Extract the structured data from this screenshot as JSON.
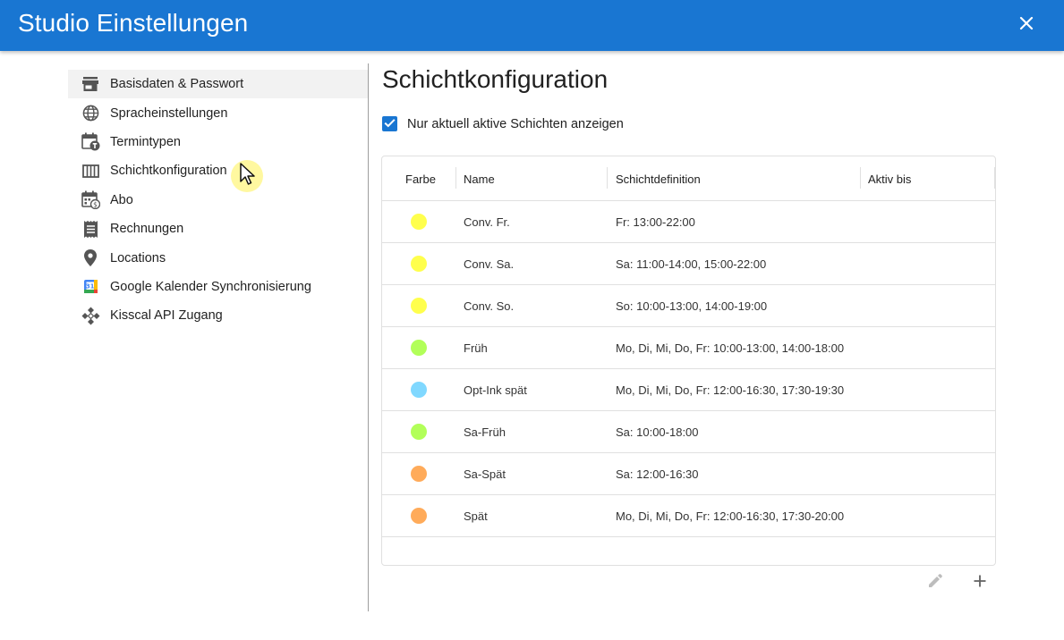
{
  "header": {
    "title": "Studio Einstellungen",
    "close_icon": "close-icon",
    "color": "#1976d2"
  },
  "sidebar": {
    "items": [
      {
        "label": "Basisdaten & Passwort",
        "icon": "store-icon",
        "active": true
      },
      {
        "label": "Spracheinstellungen",
        "icon": "globe-icon",
        "active": false
      },
      {
        "label": "Termintypen",
        "icon": "calendar-type-icon",
        "active": false
      },
      {
        "label": "Schichtkonfiguration",
        "icon": "columns-icon",
        "active": false
      },
      {
        "label": "Abo",
        "icon": "calendar-billing-icon",
        "active": false
      },
      {
        "label": "Rechnungen",
        "icon": "receipt-icon",
        "active": false
      },
      {
        "label": "Locations",
        "icon": "location-pin-icon",
        "active": false
      },
      {
        "label": "Google Kalender Synchronisierung",
        "icon": "google-calendar-icon",
        "active": false
      },
      {
        "label": "Kisscal API Zugang",
        "icon": "api-icon",
        "active": false
      }
    ]
  },
  "main": {
    "title": "Schichtkonfiguration",
    "filter_checkbox": {
      "label": "Nur aktuell aktive Schichten anzeigen",
      "checked": true
    },
    "table": {
      "columns": [
        "Farbe",
        "Name",
        "Schichtdefinition",
        "Aktiv bis"
      ],
      "rows": [
        {
          "color": "#ffff4d",
          "name": "Conv. Fr.",
          "definition": "Fr: 13:00-22:00",
          "active_until": ""
        },
        {
          "color": "#ffff4d",
          "name": "Conv. Sa.",
          "definition": "Sa: 11:00-14:00, 15:00-22:00",
          "active_until": ""
        },
        {
          "color": "#ffff4d",
          "name": "Conv. So.",
          "definition": "So: 10:00-13:00, 14:00-19:00",
          "active_until": ""
        },
        {
          "color": "#b2ff59",
          "name": "Früh",
          "definition": "Mo, Di, Mi, Do, Fr: 10:00-13:00, 14:00-18:00",
          "active_until": ""
        },
        {
          "color": "#80d8ff",
          "name": "Opt-Ink spät",
          "definition": "Mo, Di, Mi, Do, Fr: 12:00-16:30, 17:30-19:30",
          "active_until": ""
        },
        {
          "color": "#b2ff59",
          "name": "Sa-Früh",
          "definition": "Sa: 10:00-18:00",
          "active_until": ""
        },
        {
          "color": "#ffab5a",
          "name": "Sa-Spät",
          "definition": "Sa: 12:00-16:30",
          "active_until": ""
        },
        {
          "color": "#ffab5a",
          "name": "Spät",
          "definition": "Mo, Di, Mi, Do, Fr: 12:00-16:30, 17:30-20:00",
          "active_until": ""
        }
      ]
    },
    "actions": {
      "edit_icon": "pencil-icon",
      "add_icon": "plus-icon"
    }
  }
}
